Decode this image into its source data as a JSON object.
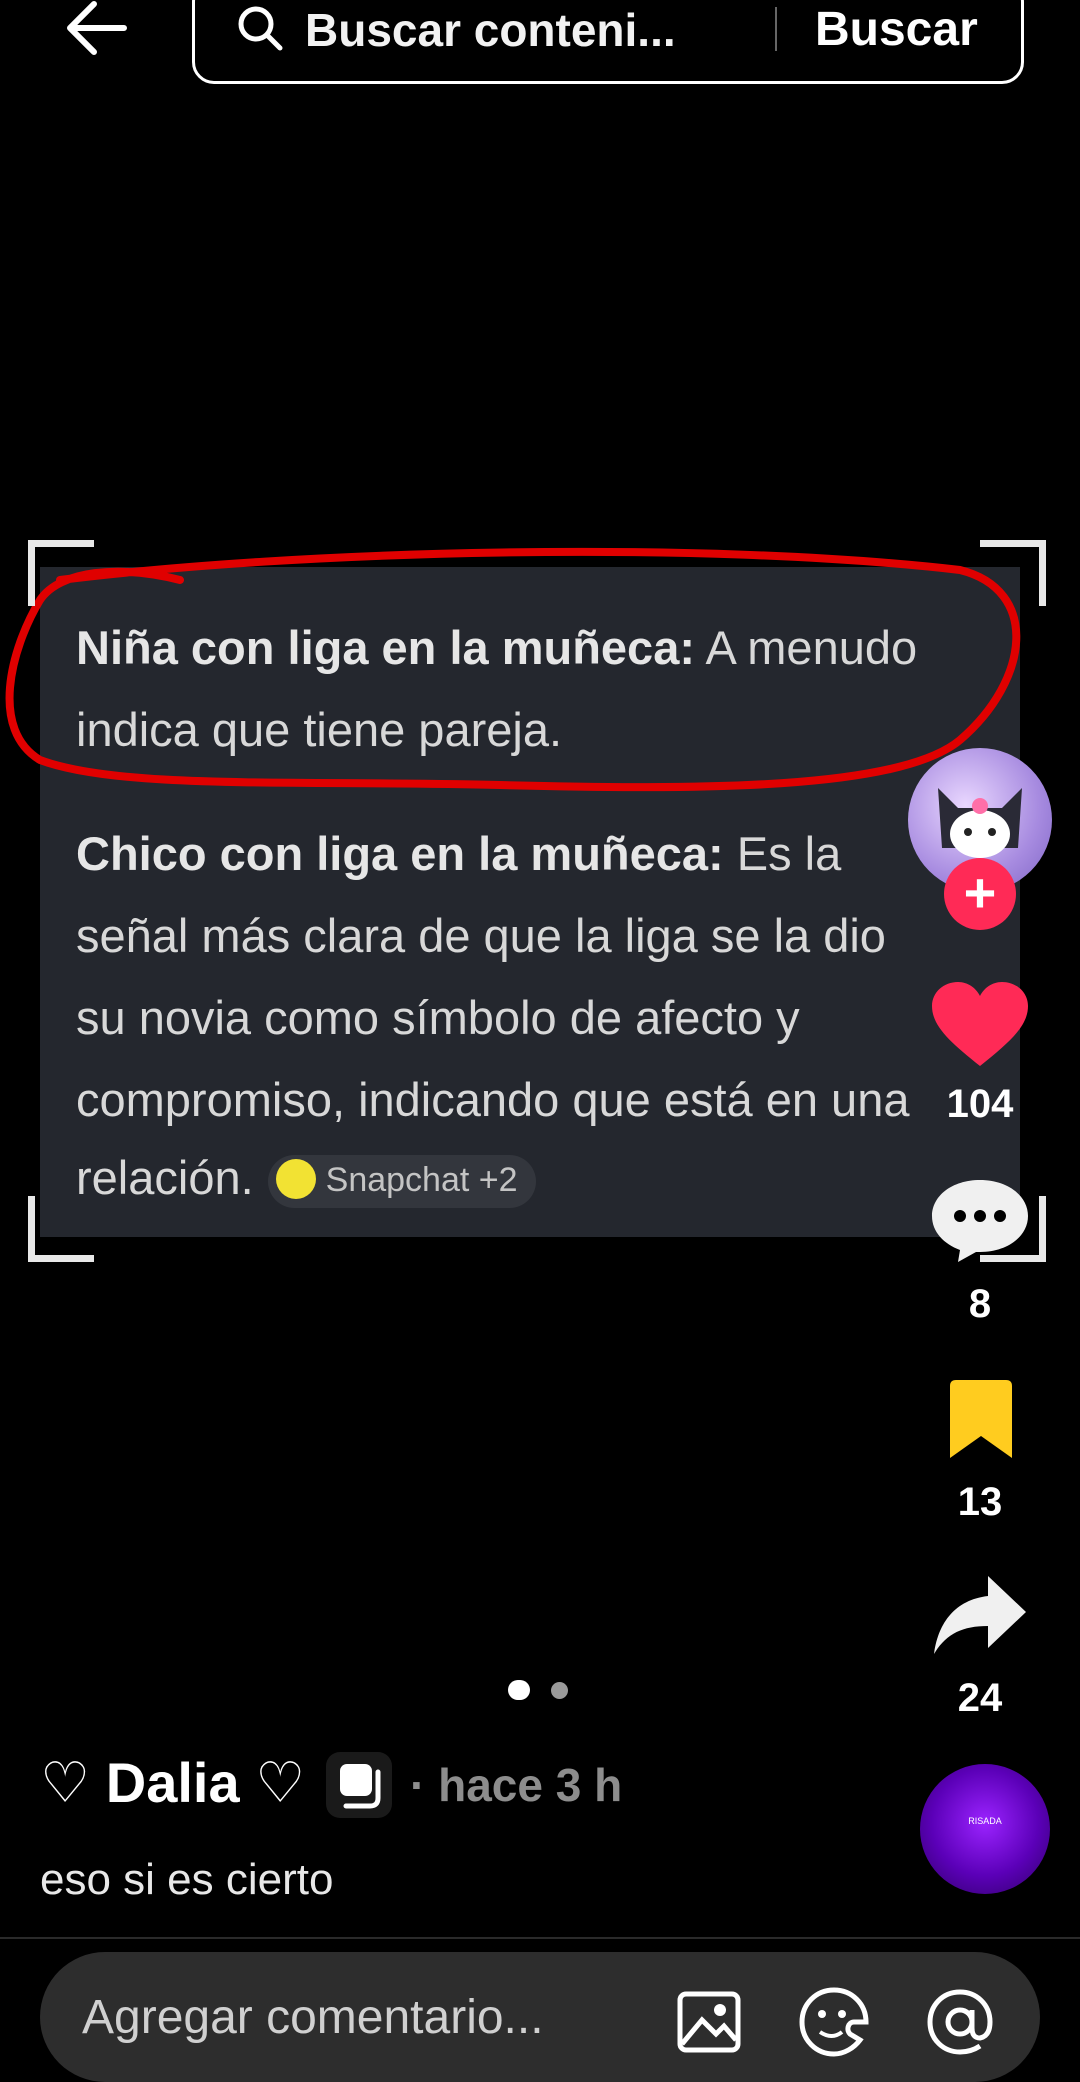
{
  "header": {
    "search_placeholder": "Buscar conteni...",
    "search_button": "Buscar"
  },
  "post": {
    "para1_bold": "Niña con liga en la muñeca:",
    "para1_rest_line1": " A menudo",
    "para1_line2": "indica que tiene pareja.",
    "para2_bold": "Chico con liga en la muñeca:",
    "para2_rest_line1": " Es la",
    "para2_line2": "señal más clara de que la liga se la dio",
    "para2_line3": "su novia como símbolo de afecto y",
    "para2_line4": "compromiso, indicando que está en una",
    "para2_line5": "relación.",
    "source_chip": "Snapchat +2"
  },
  "actions": {
    "likes": "104",
    "comments": "8",
    "saves": "13",
    "shares": "24"
  },
  "author": {
    "name": "♡ Dalia ♡",
    "time": "· hace 3 h",
    "caption": "eso si es cierto"
  },
  "music_disc_text": "RISADA",
  "comment_bar": {
    "placeholder": "Agregar comentario..."
  },
  "colors": {
    "like": "#ff2a56",
    "save": "#ffcc1f",
    "annotation": "#e00000"
  }
}
